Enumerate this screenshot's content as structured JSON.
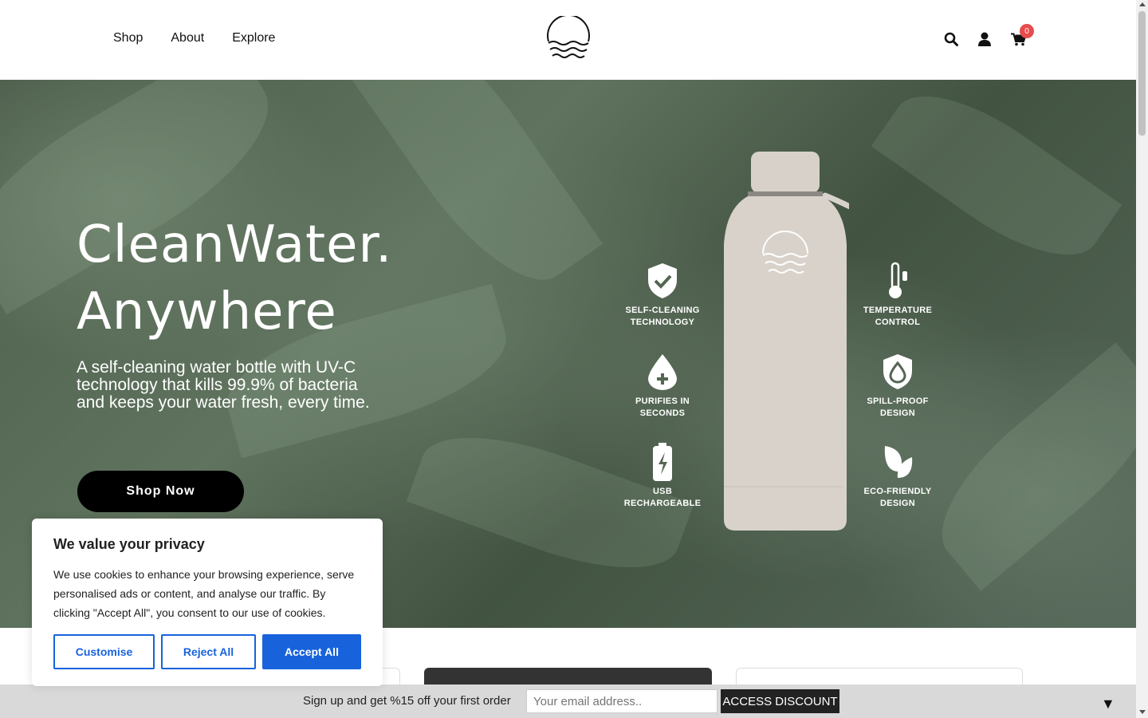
{
  "header": {
    "nav": [
      "Shop",
      "About",
      "Explore"
    ],
    "cart_count": "0",
    "icons": [
      "search-icon",
      "user-icon",
      "cart-icon"
    ]
  },
  "hero": {
    "title_line1": "CleanWater.",
    "title_line2": "Anywhere",
    "subtitle": "A self-cleaning water bottle with UV-C technology that kills 99.9% of bacteria and keeps your water fresh, every time.",
    "cta": "Shop Now",
    "features": [
      {
        "label": "SELF-CLEANING\nTECHNOLOGY",
        "icon": "shield-check-icon"
      },
      {
        "label": "TEMPERATURE\nCONTROL",
        "icon": "thermometer-icon"
      },
      {
        "label": "PURIFIES IN\nSECONDS",
        "icon": "drop-plus-icon"
      },
      {
        "label": "SPILL-PROOF\nDESIGN",
        "icon": "shield-drop-icon"
      },
      {
        "label": "USB\nRECHARGEABLE",
        "icon": "battery-icon"
      },
      {
        "label": "ECO-FRIENDLY\nDESIGN",
        "icon": "leaf-icon"
      }
    ]
  },
  "cookie": {
    "title": "We value your privacy",
    "body": "We use cookies to enhance your browsing experience, serve personalised ads or content, and analyse our traffic. By clicking \"Accept All\", you consent to our use of cookies.",
    "customise": "Customise",
    "reject": "Reject All",
    "accept": "Accept All"
  },
  "signup": {
    "text": "Sign up and get %15 off your first order",
    "placeholder": "Your email address..",
    "button": "ACCESS DISCOUNT",
    "toggle": "▼"
  },
  "colors": {
    "accent": "#1863dc",
    "badge": "#e74c4c",
    "cta_bg": "#000000",
    "signup_bg": "#d9d9d9"
  }
}
